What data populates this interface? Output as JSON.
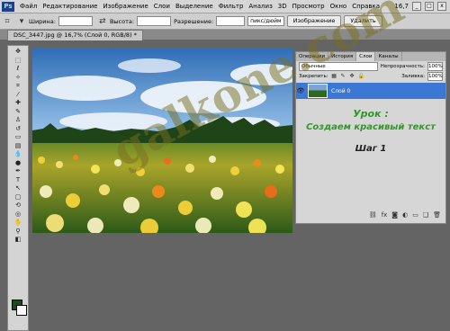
{
  "menubar": {
    "logo": "Ps",
    "items": [
      "Файл",
      "Редактирование",
      "Изображение",
      "Слои",
      "Выделение",
      "Фильтр",
      "Анализ",
      "3D",
      "Просмотр",
      "Окно",
      "Справка"
    ],
    "zoom": "16,7",
    "win_min": "_",
    "win_max": "□",
    "win_close": "x"
  },
  "options": {
    "width_label": "Ширина:",
    "height_label": "Высота:",
    "resolution_label": "Разрешение:",
    "resolution_unit": "пикс/дюйм",
    "image_button": "Изображение",
    "clear_button": "Удалить"
  },
  "document_tab": "DSC_3447.jpg @ 16,7% (Слой 0, RGB/8) *",
  "layers_panel": {
    "tabs": [
      "Операции",
      "История",
      "Слои",
      "Каналы"
    ],
    "active_tab": 2,
    "blend_mode": "Обычные",
    "opacity_label": "Непрозрачность:",
    "opacity_value": "100%",
    "lock_label": "Закрепить:",
    "fill_label": "Заливка:",
    "fill_value": "100%",
    "layer_name": "Слой 0"
  },
  "lesson": {
    "line1": "Урок :",
    "line2": "Создаем красивый текст",
    "line3": "Шаг 1"
  },
  "watermark": "galkone.com",
  "colors": {
    "foreground": "#1f4a1e",
    "background": "#ffffff",
    "layer_selected": "#3a78d3",
    "lesson_green": "#2f9a25"
  }
}
